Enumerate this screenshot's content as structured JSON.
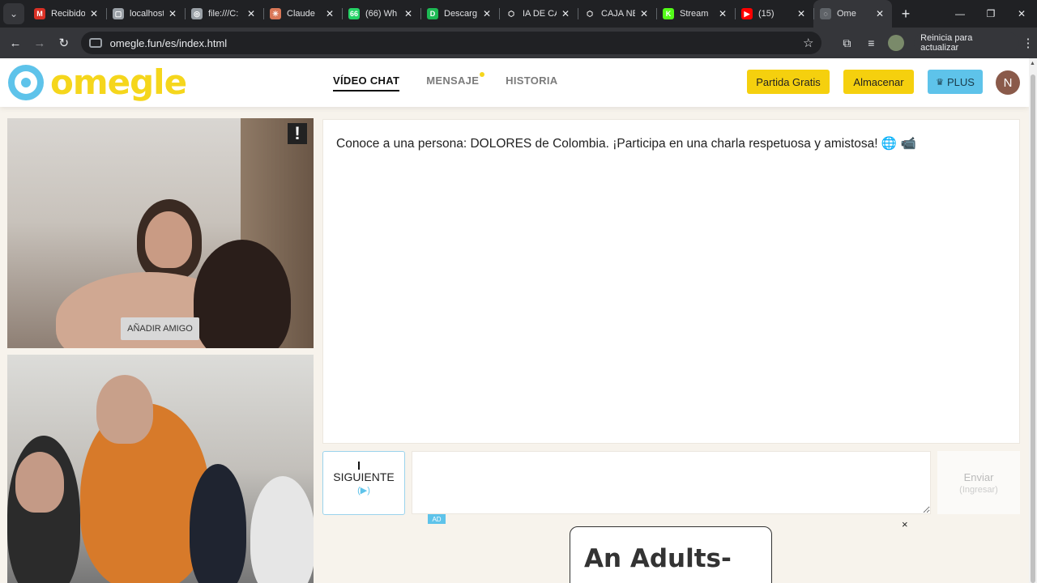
{
  "browser": {
    "tabs": [
      {
        "label": "Recibido",
        "favicon": "gmail-icon",
        "color": "#d93025",
        "glyph": "M"
      },
      {
        "label": "localhost",
        "favicon": "page-icon",
        "color": "#9aa0a6",
        "glyph": "▢"
      },
      {
        "label": "file:///C:",
        "favicon": "globe-icon",
        "color": "#9aa0a6",
        "glyph": "◎"
      },
      {
        "label": "Claude",
        "favicon": "claude-icon",
        "color": "#d97757",
        "glyph": "✳"
      },
      {
        "label": "(66) Wh",
        "favicon": "whatsapp-icon",
        "color": "#25d366",
        "glyph": "66"
      },
      {
        "label": "Descarg",
        "favicon": "d-icon",
        "color": "#1db954",
        "glyph": "D"
      },
      {
        "label": "IA DE CA",
        "favicon": "openai-icon",
        "color": "#202124",
        "glyph": "⬡"
      },
      {
        "label": "CAJA NE",
        "favicon": "openai-icon",
        "color": "#202124",
        "glyph": "⬡"
      },
      {
        "label": "Stream",
        "favicon": "kick-icon",
        "color": "#53fc18",
        "glyph": "K"
      },
      {
        "label": "(15)",
        "favicon": "youtube-icon",
        "color": "#ff0000",
        "glyph": "▶"
      },
      {
        "label": "Ome",
        "favicon": "omegle-icon",
        "color": "#5f6368",
        "glyph": "◌",
        "active": true
      }
    ],
    "url": "omegle.fun/es/index.html",
    "update_label": "Reinicia para actualizar"
  },
  "site": {
    "logo_text": "omegle",
    "nav": {
      "video_chat": "VÍDEO CHAT",
      "message": "MENSAJE",
      "history": "HISTORIA"
    },
    "buttons": {
      "free_game": "Partida Gratis",
      "store": "Almacenar",
      "plus": "PLUS"
    },
    "avatar_initial": "N"
  },
  "video": {
    "report_label": "!",
    "add_friend": "AÑADIR AMIGO"
  },
  "chat": {
    "message": "Conoce a una persona: DOLORES de Colombia. ¡Participa en una charla respetuosa y amistosa! 🌐 📹",
    "skip_label": "SIGUIENTE",
    "skip_hint": "(▶)",
    "send_label": "Enviar",
    "send_hint": "(Ingresar)",
    "input_value": ""
  },
  "ad": {
    "badge": "AD",
    "close": "×",
    "title": "An Adults-"
  },
  "colors": {
    "brand_yellow": "#f5d00e",
    "brand_blue": "#5ec3ea"
  }
}
